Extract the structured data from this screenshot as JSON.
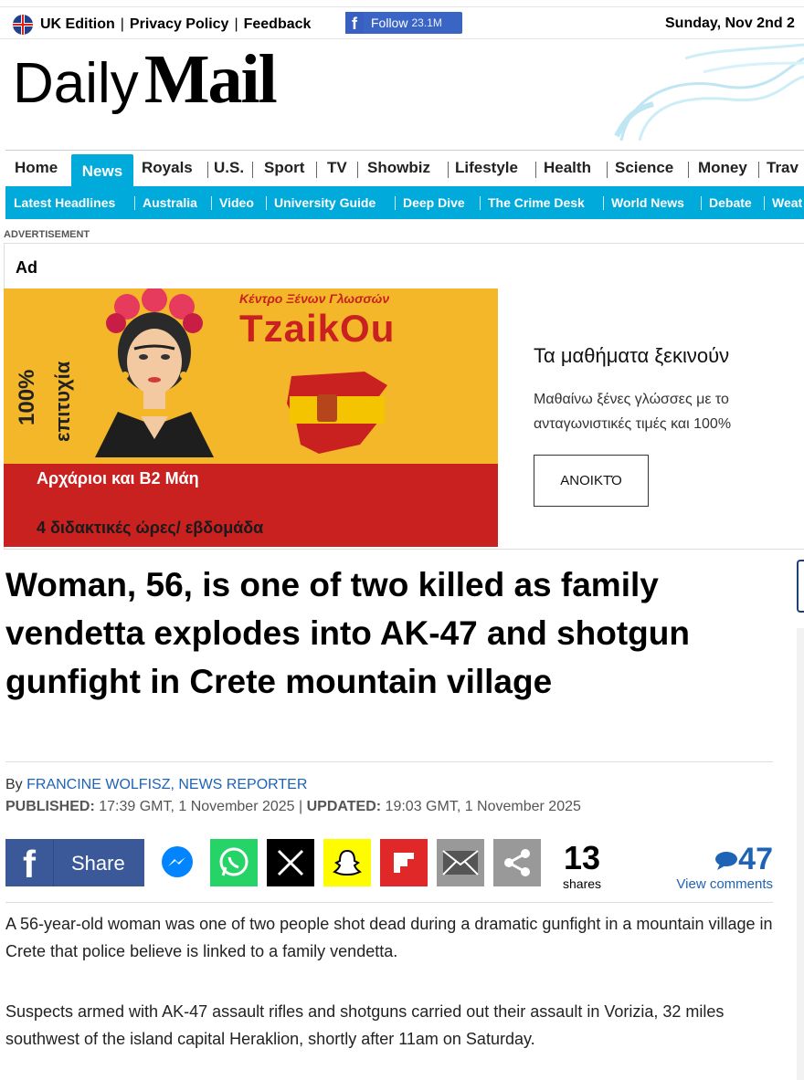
{
  "topbar": {
    "edition": "UK Edition",
    "privacy": "Privacy Policy",
    "feedback": "Feedback",
    "follow_label": "Follow",
    "follow_count": "23.1M",
    "date": "Sunday, Nov 2nd 2"
  },
  "masthead": {
    "daily": "Daily",
    "mail": "Mail"
  },
  "nav_primary": [
    "Home",
    "News",
    "Royals",
    "U.S.",
    "Sport",
    "TV",
    "Showbiz",
    "Lifestyle",
    "Health",
    "Science",
    "Money",
    "Trav"
  ],
  "nav_secondary": [
    "Latest Headlines",
    "Australia",
    "Video",
    "University Guide",
    "Deep Dive",
    "The Crime Desk",
    "World News",
    "Debate",
    "Weat"
  ],
  "ad": {
    "advertisement_label": "ADVERTISEMENT",
    "ad_label": "Ad",
    "image": {
      "brand_small": "Κέντρο Ξένων Γλωσσών",
      "brand": "TzaikOu",
      "vertical_1": "100%",
      "vertical_2": "επιτυχία",
      "line1": "Αρχάριοι και Β2 Μάη",
      "line2": "4 διδακτικές ώρες/ εβδομάδα"
    },
    "title": "Τα μαθήματα ξεκινούν",
    "text_line1": "Μαθαίνω ξένες γλώσσες με το",
    "text_line2": "ανταγωνιστικές τιμές και 100%",
    "button": "ΑΝΟΙΚΤΌ"
  },
  "article": {
    "headline": "Woman, 56, is one of two killed as family vendetta explodes into AK-47 and shotgun gunfight in Crete mountain village",
    "by": "By",
    "author": "FRANCINE WOLFISZ, NEWS REPORTER",
    "published_label": "PUBLISHED:",
    "published": " 17:39 GMT, 1 November 2025 ",
    "updated_label": "UPDATED:",
    "updated": " 19:03 GMT, 1 November 2025",
    "share_label": "Share",
    "share_count": "13",
    "shares_label": "shares",
    "comment_count": "47",
    "comments_label": "View comments",
    "paragraphs": [
      "A 56-year-old woman was one of two people shot dead during a dramatic gunfight in a mountain village in Crete that police believe is linked to a family vendetta.",
      "Suspects armed with AK-47 assault rifles and shotguns carried out their assault in Vorizia, 32 miles southwest of the island capital Heraklion, shortly after 11am on Saturday."
    ]
  },
  "colors": {
    "nav_blue": "#00aadb",
    "facebook": "#3b5998",
    "messenger": "#0084ff",
    "whatsapp": "#25d366",
    "x": "#000000",
    "snapchat": "#fffc00",
    "flipboard": "#e12828",
    "email": "#999999",
    "share_more": "#999999",
    "link_blue": "#1e63b5"
  },
  "icons": [
    "uk-flag-icon",
    "facebook-icon",
    "messenger-icon",
    "whatsapp-icon",
    "x-icon",
    "snapchat-icon",
    "flipboard-icon",
    "email-icon",
    "share-icon",
    "comment-bubble-icon"
  ]
}
